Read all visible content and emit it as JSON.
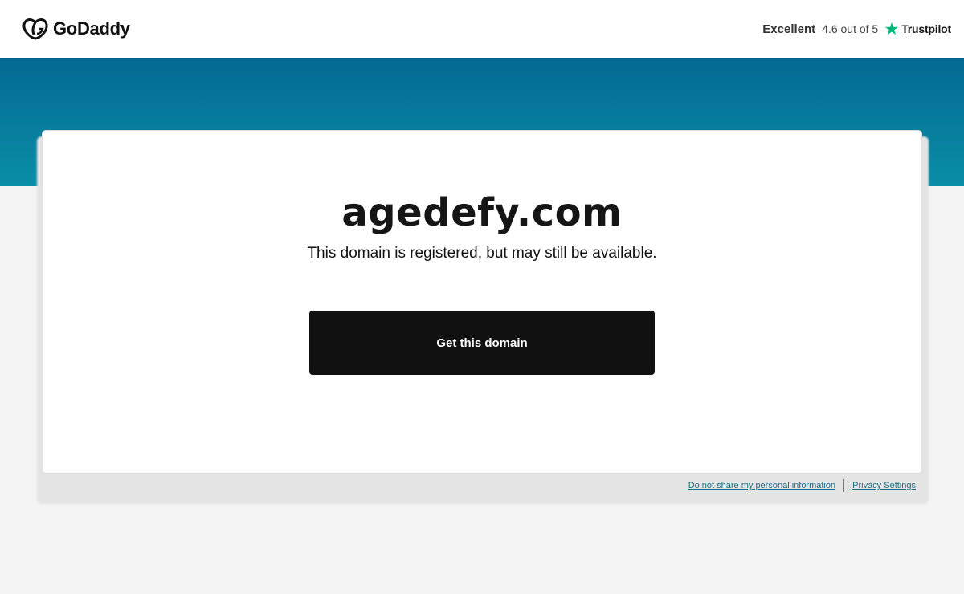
{
  "brand": {
    "name": "GoDaddy"
  },
  "rating": {
    "word": "Excellent",
    "score": "4.6 out of 5",
    "provider": "Trustpilot",
    "star_color": "#00b67a"
  },
  "main": {
    "domain": "agedefy.com",
    "status": "This domain is registered, but may still be available.",
    "cta_label": "Get this domain"
  },
  "footer": {
    "links": [
      {
        "label": "Do not share my personal information"
      },
      {
        "label": "Privacy Settings"
      }
    ]
  },
  "colors": {
    "band_top": "#036a93",
    "band_bottom": "#0a8ea6",
    "button": "#111111",
    "link": "#1b6d85"
  }
}
